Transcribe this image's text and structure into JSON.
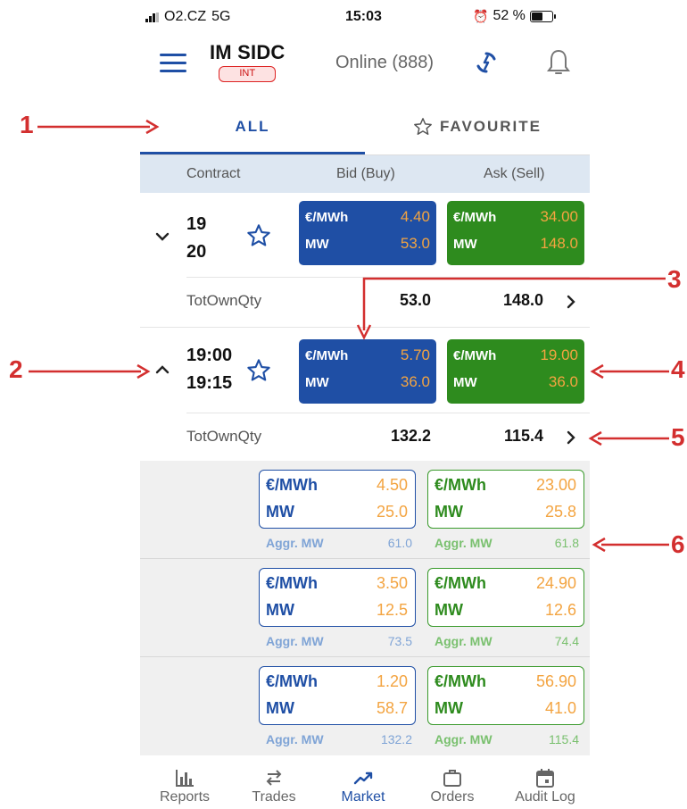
{
  "status_bar": {
    "carrier": "O2.CZ",
    "network": "5G",
    "time": "15:03",
    "battery": "52 %",
    "battery_level": 0.52
  },
  "header": {
    "title": "IM SIDC",
    "badge": "INT",
    "online_status": "Online (888)"
  },
  "tabs": {
    "all": "ALL",
    "favourite": "FAVOURITE"
  },
  "columns": {
    "contract": "Contract",
    "bid": "Bid (Buy)",
    "ask": "Ask (Sell)"
  },
  "units": {
    "price": "€/MWh",
    "qty": "MW",
    "aggr": "Aggr. MW",
    "tot_label": "TotOwnQty"
  },
  "contracts": [
    {
      "line1": "19",
      "line2": "20",
      "bid": {
        "price": "4.40",
        "qty": "53.0"
      },
      "ask": {
        "price": "34.00",
        "qty": "148.0"
      },
      "tot_bid": "53.0",
      "tot_ask": "148.0"
    },
    {
      "line1": "19:00",
      "line2": "19:15",
      "bid": {
        "price": "5.70",
        "qty": "36.0"
      },
      "ask": {
        "price": "19.00",
        "qty": "36.0"
      },
      "tot_bid": "132.2",
      "tot_ask": "115.4"
    }
  ],
  "depth": [
    {
      "bid_price": "4.50",
      "bid_qty": "25.0",
      "bid_aggr": "61.0",
      "ask_price": "23.00",
      "ask_qty": "25.8",
      "ask_aggr": "61.8"
    },
    {
      "bid_price": "3.50",
      "bid_qty": "12.5",
      "bid_aggr": "73.5",
      "ask_price": "24.90",
      "ask_qty": "12.6",
      "ask_aggr": "74.4"
    },
    {
      "bid_price": "1.20",
      "bid_qty": "58.7",
      "bid_aggr": "132.2",
      "ask_price": "56.90",
      "ask_qty": "41.0",
      "ask_aggr": "115.4"
    }
  ],
  "bottom_nav": [
    {
      "label": "Reports",
      "icon": "bar-chart-icon"
    },
    {
      "label": "Trades",
      "icon": "swap-arrows-icon"
    },
    {
      "label": "Market",
      "icon": "trend-up-icon",
      "active": true
    },
    {
      "label": "Orders",
      "icon": "briefcase-icon"
    },
    {
      "label": "Audit Log",
      "icon": "calendar-icon"
    }
  ],
  "annotations": [
    "1",
    "2",
    "3",
    "4",
    "5",
    "6"
  ],
  "colors": {
    "primary_blue": "#1f4fa5",
    "ask_green": "#2e8b1e",
    "price_orange": "#f3a441",
    "annotation_red": "#d32f2f",
    "header_band": "#dde7f2"
  }
}
